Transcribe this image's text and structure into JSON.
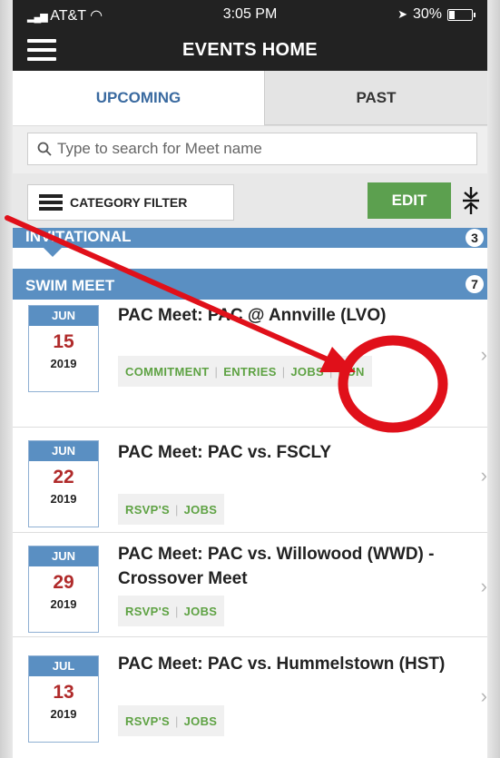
{
  "status_bar": {
    "carrier": "AT&T",
    "time": "3:05 PM",
    "battery": "30%"
  },
  "header": {
    "title": "EVENTS HOME"
  },
  "tabs": [
    {
      "label": "UPCOMING",
      "active": true
    },
    {
      "label": "PAST",
      "active": false
    }
  ],
  "search": {
    "placeholder": "Type to search for Meet name"
  },
  "toolbar": {
    "category_filter_label": "CATEGORY FILTER",
    "edit_label": "EDIT"
  },
  "sections": [
    {
      "label": "INVITATIONAL",
      "count": "3"
    },
    {
      "label": "SWIM MEET",
      "count": "7"
    }
  ],
  "events": [
    {
      "month": "JUN",
      "day": "15",
      "year": "2019",
      "name": "PAC Meet:  PAC @ Annville (LVO)",
      "actions": [
        "COMMITMENT",
        "ENTRIES",
        "JOBS",
        "RUN"
      ]
    },
    {
      "month": "JUN",
      "day": "22",
      "year": "2019",
      "name": "PAC Meet:  PAC vs. FSCLY",
      "actions": [
        "RSVP'S",
        "JOBS"
      ]
    },
    {
      "month": "JUN",
      "day": "29",
      "year": "2019",
      "name": "PAC Meet:  PAC vs. Willowood (WWD) - Crossover Meet",
      "actions": [
        "RSVP'S",
        "JOBS"
      ]
    },
    {
      "month": "JUL",
      "day": "13",
      "year": "2019",
      "name": "PAC Meet:  PAC vs. Hummelstown (HST)",
      "actions": [
        "RSVP'S",
        "JOBS"
      ]
    }
  ],
  "colors": {
    "header": "#222222",
    "section": "#5a8fc2",
    "edit": "#5ca04f",
    "action_text": "#5ea243",
    "date_day": "#b02a2a",
    "annotation": "#e0101a"
  }
}
